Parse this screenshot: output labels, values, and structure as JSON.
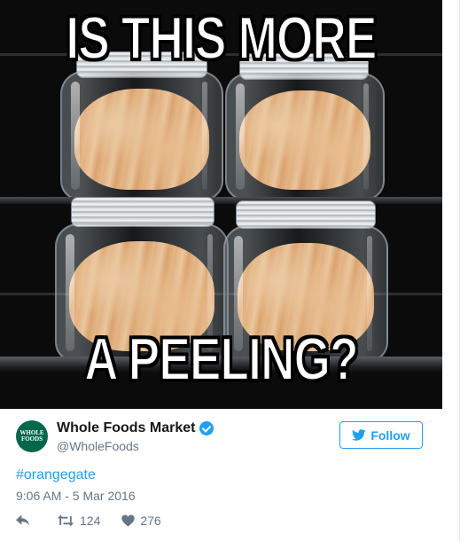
{
  "meme": {
    "top_text": "IS THIS MORE",
    "bottom_text": "A PEELING?"
  },
  "tweet": {
    "author": {
      "display_name": "Whole Foods Market",
      "handle": "@WholeFoods",
      "avatar_text_line1": "WHOLE",
      "avatar_text_line2": "FOODS",
      "avatar_color": "#00674b",
      "verified": true
    },
    "follow_label": "Follow",
    "text": "#orangegate",
    "timestamp": "9:06 AM - 5 Mar 2016",
    "actions": {
      "retweet_count": "124",
      "like_count": "276"
    }
  },
  "colors": {
    "accent": "#1da1f2",
    "secondary_text": "#657786",
    "primary_text": "#14171a"
  }
}
